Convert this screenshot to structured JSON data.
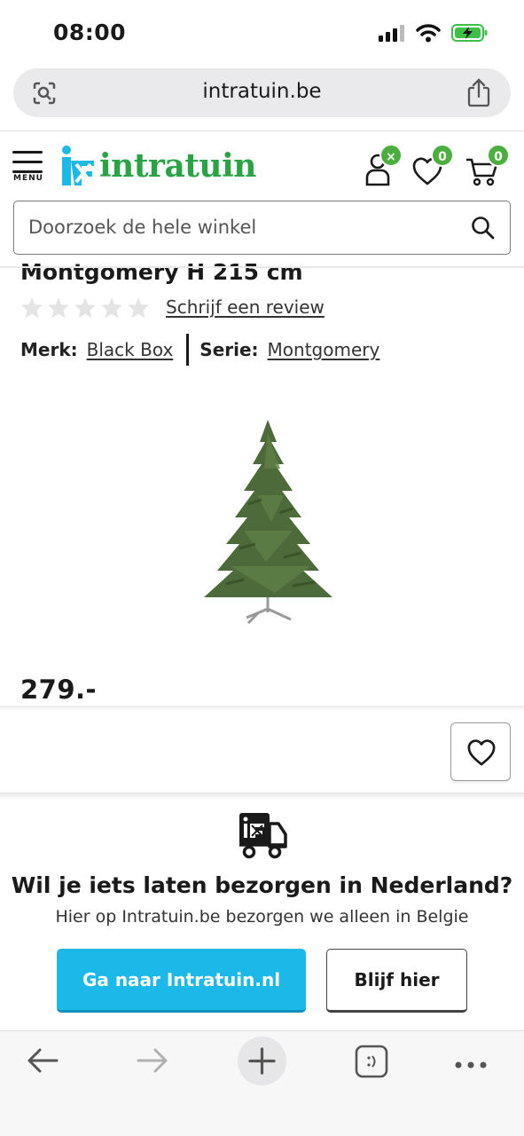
{
  "status_bar": {
    "time": "08:00",
    "icons": [
      "signal-icon",
      "wifi-icon",
      "battery-charging-icon"
    ]
  },
  "browser": {
    "url": "intratuin.be",
    "left_icon": "page-lens-icon",
    "right_icon": "share-icon"
  },
  "header": {
    "menu_label": "MENU",
    "logo_text": "intratuin",
    "account_badge": "×",
    "wishlist_count": "0",
    "cart_count": "0"
  },
  "search": {
    "placeholder": "Doorzoek de hele winkel"
  },
  "product": {
    "title": "Montgomery H 215 cm",
    "rating_stars": 5,
    "rating_value": 0,
    "review_link": "Schrijf een review",
    "brand_label": "Merk:",
    "brand": "Black Box",
    "series_label": "Serie:",
    "series": "Montgomery",
    "image": "christmas-tree",
    "price": "279.-"
  },
  "delivery_banner": {
    "title": "Wil je iets laten bezorgen in Nederland?",
    "subtitle": "Hier op Intratuin.be bezorgen we alleen in Belgie",
    "primary_button": "Ga naar Intratuin.nl",
    "secondary_button": "Blijf hier"
  },
  "bottom_bar": {
    "icons": [
      "back-arrow-icon",
      "forward-arrow-icon",
      "new-tab-plus-icon",
      "tabs-icon",
      "more-icon"
    ]
  },
  "colors": {
    "brand_green": "#4cae3e",
    "brand_blue": "#1cb8e8",
    "text": "#1a1a1a"
  }
}
